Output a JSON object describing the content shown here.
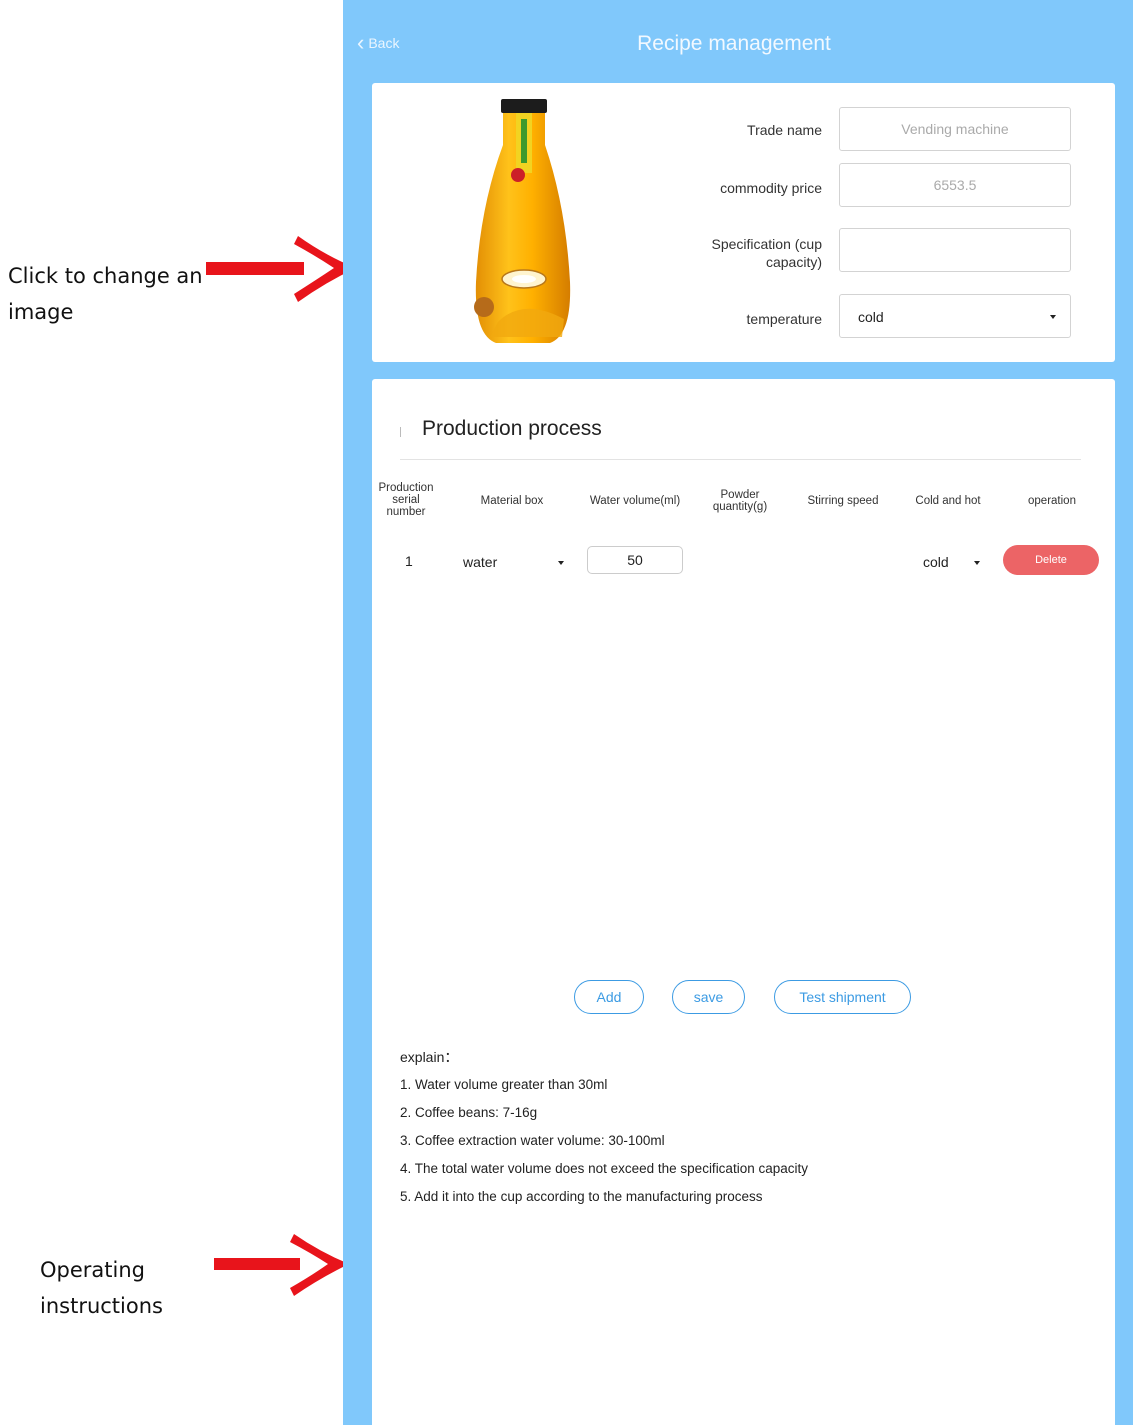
{
  "annotations": {
    "change_image": "Click to change an image",
    "operating_instructions_1": "Operating",
    "operating_instructions_2": "instructions"
  },
  "header": {
    "back_label": "Back",
    "title": "Recipe management"
  },
  "product": {
    "image_icon": "juice-bottle-image",
    "trade_name_label": "Trade name",
    "trade_name_placeholder": "Vending machine",
    "price_label": "commodity price",
    "price_placeholder": "6553.5",
    "spec_label": "Specification (cup capacity)",
    "spec_value": "",
    "temperature_label": "temperature",
    "temperature_value": "cold"
  },
  "process": {
    "title": "Production process",
    "columns": [
      "Production serial number",
      "Material box",
      "Water volume(ml)",
      "Powder quantity(g)",
      "Stirring speed",
      "Cold and hot",
      "operation"
    ],
    "rows": [
      {
        "serial": "1",
        "material": "water",
        "water_volume": "50",
        "powder": "",
        "stirring": "",
        "temp": "cold",
        "action": "Delete"
      }
    ],
    "buttons": {
      "add": "Add",
      "save": "save",
      "test": "Test shipment"
    }
  },
  "explain": {
    "title": "explain：",
    "items": [
      "1. Water volume greater than 30ml",
      "2. Coffee beans: 7-16g",
      "3. Coffee extraction water volume: 30-100ml",
      "4. The total water volume does not exceed the specification capacity",
      "5. Add it into the cup according to the manufacturing process"
    ]
  },
  "colors": {
    "frame_blue": "#80c8fb",
    "accent_blue": "#3c9be3",
    "delete_red": "#ec6466",
    "arrow_red": "#e8141b"
  }
}
